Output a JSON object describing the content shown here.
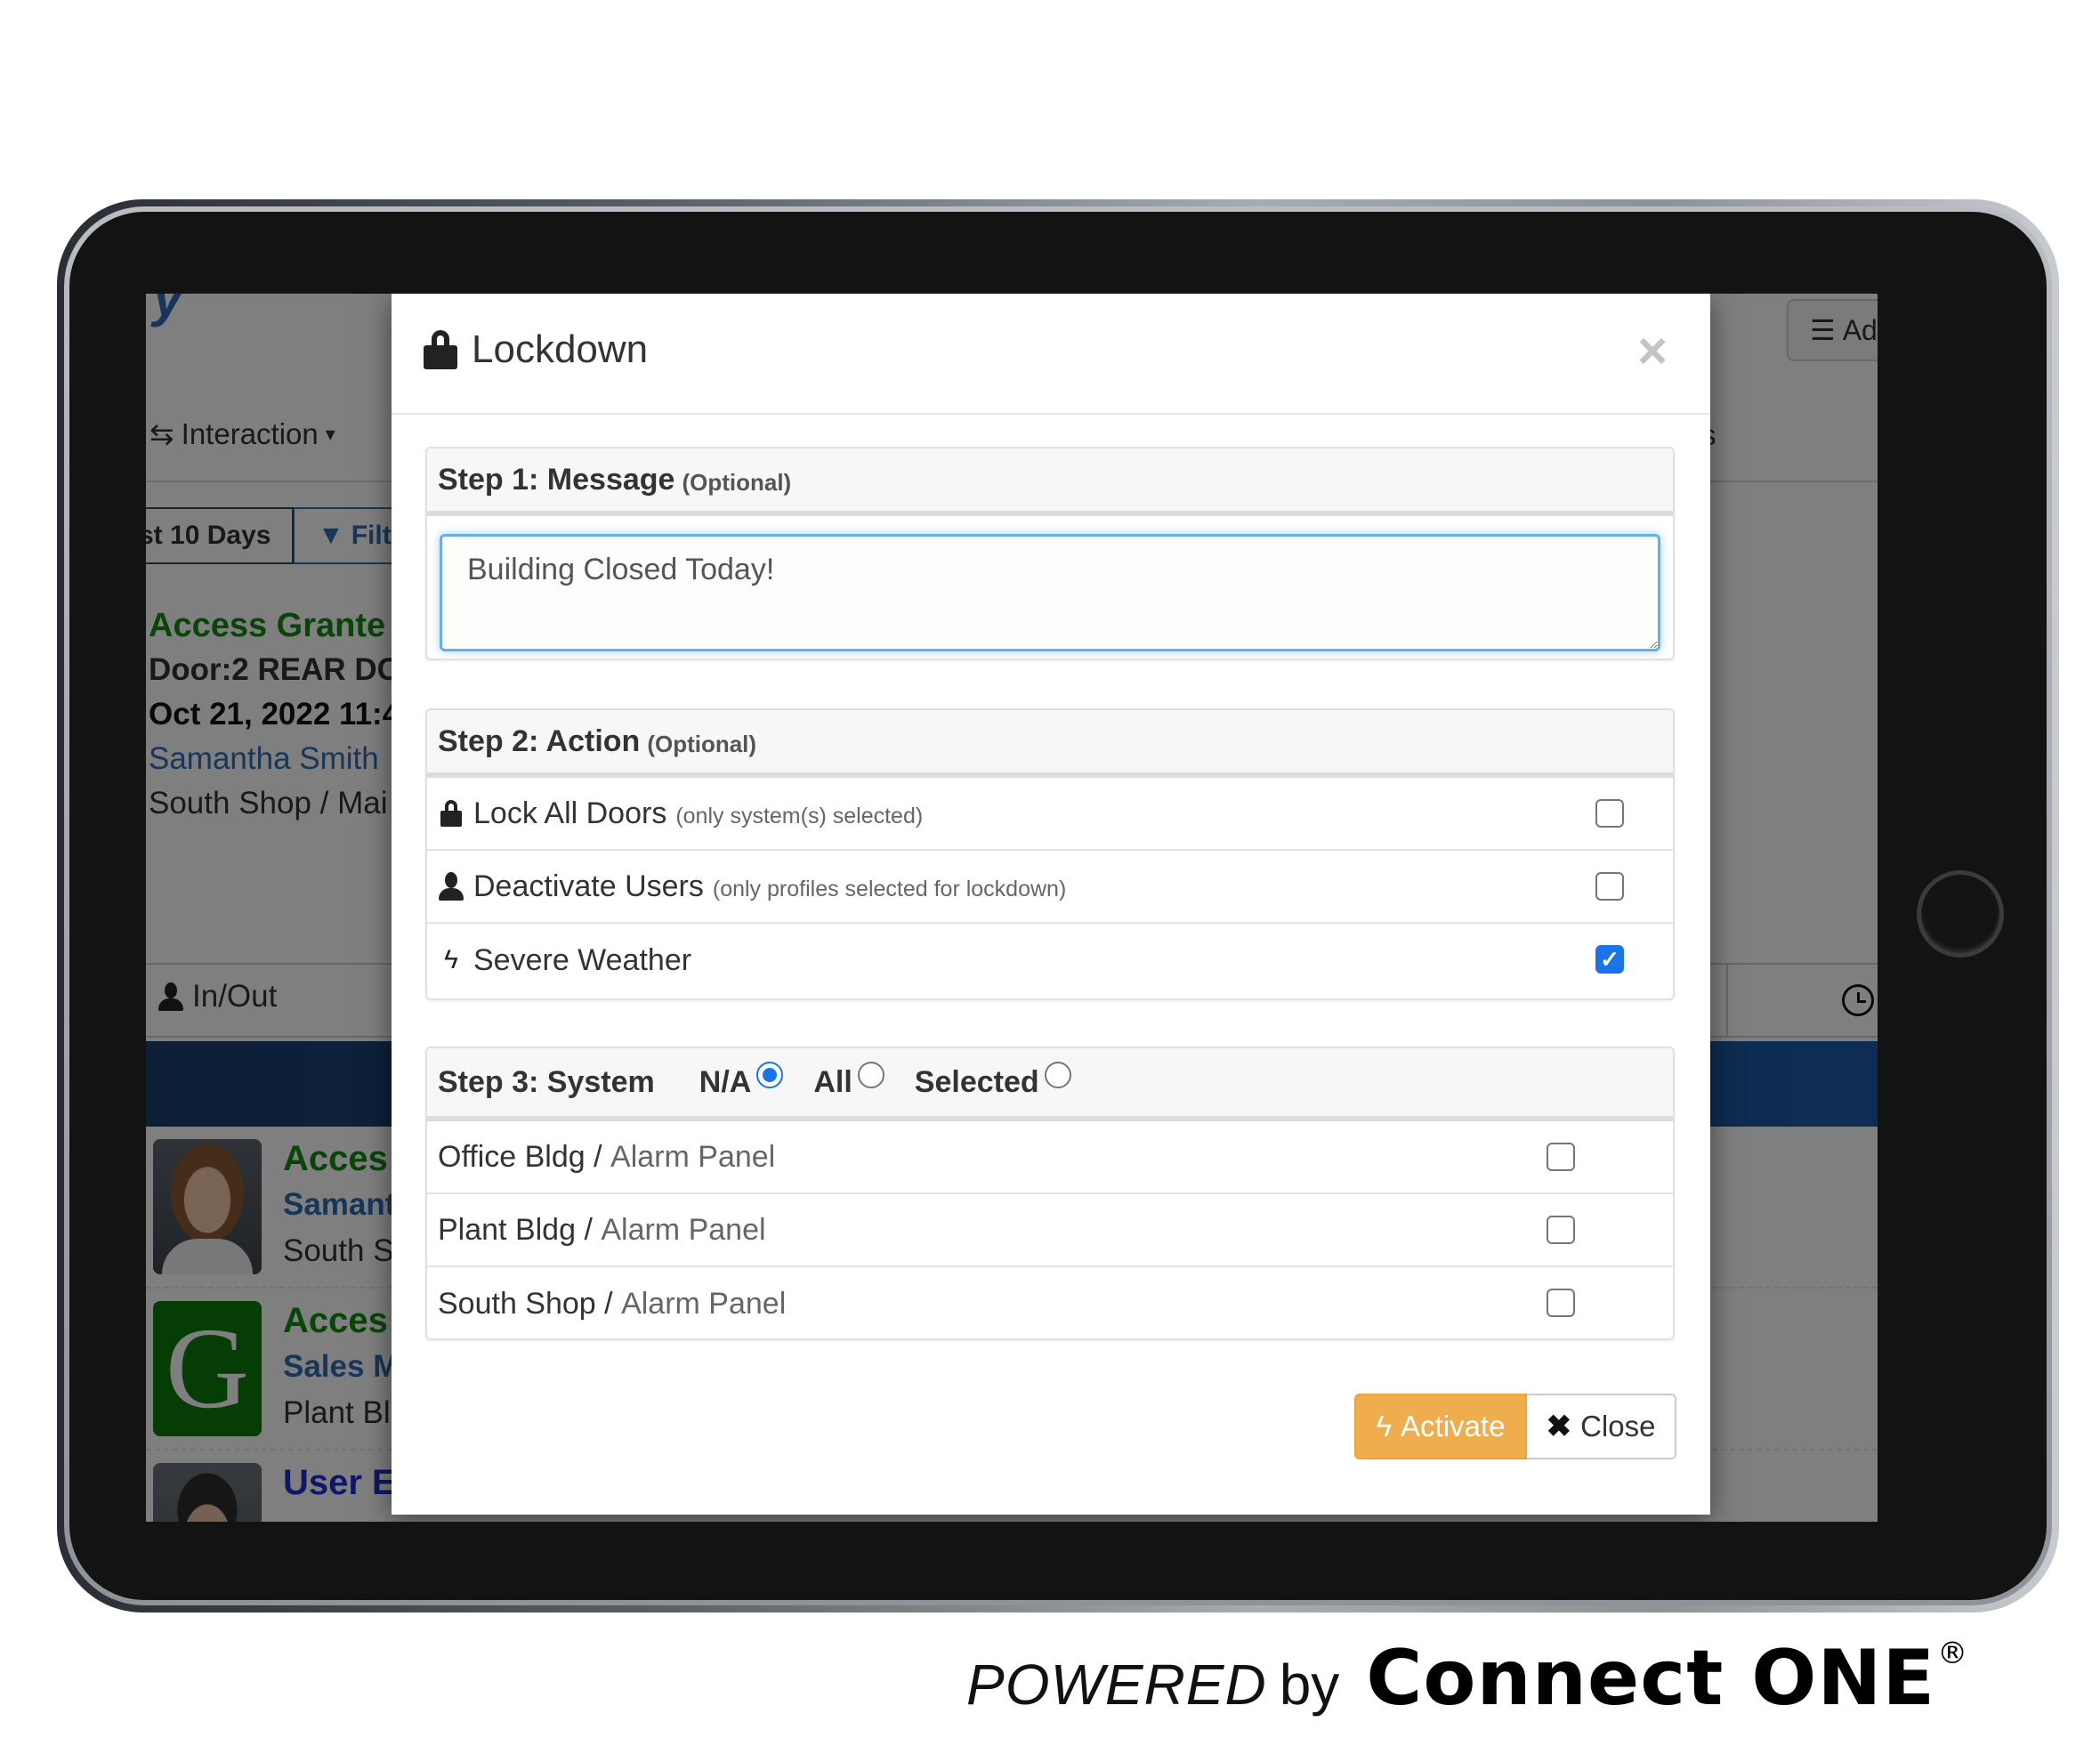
{
  "background_app": {
    "nav": {
      "interaction_label": "Interaction",
      "right_fragment": "s",
      "admin_fragment": "Ad"
    },
    "filters": {
      "days_label": "st 10 Days",
      "filter_label": "Filt"
    },
    "latest_event": {
      "status": "Access Grante",
      "door": "Door:2 REAR DC",
      "date": "Oct 21, 2022 11:4",
      "person": "Samantha Smith",
      "location": "South Shop / Mai"
    },
    "inout_label": "In/Out",
    "list": [
      {
        "avatar": "photo-woman",
        "line1": "Acces",
        "line2": "Samant",
        "line3": "South S"
      },
      {
        "avatar": "letter",
        "avatar_letter": "G",
        "line1": "Acces",
        "line2": "Sales M",
        "line3": "Plant Bl"
      },
      {
        "avatar": "photo-man",
        "line1": "User E"
      }
    ]
  },
  "modal": {
    "title": "Lockdown",
    "title_icon": "lock-icon",
    "close_glyph": "×",
    "step1": {
      "title": "Step 1: Message",
      "optional": "(Optional)",
      "message_value": "Building Closed Today!"
    },
    "step2": {
      "title": "Step 2: Action",
      "optional": "(Optional)",
      "actions": [
        {
          "icon": "lock-icon",
          "label": "Lock All Doors",
          "note": "(only system(s) selected)",
          "checked": false
        },
        {
          "icon": "user-icon",
          "label": "Deactivate Users",
          "note": "(only profiles selected for lockdown)",
          "checked": false
        },
        {
          "icon": "bolt-icon",
          "label": "Severe Weather",
          "note": "",
          "checked": true
        }
      ]
    },
    "step3": {
      "title": "Step 3: System",
      "options": [
        {
          "label": "N/A",
          "selected": true
        },
        {
          "label": "All",
          "selected": false
        },
        {
          "label": "Selected",
          "selected": false
        }
      ],
      "systems": [
        {
          "building": "Office Bldg /",
          "panel": "Alarm Panel",
          "checked": false
        },
        {
          "building": "Plant Bldg /",
          "panel": "Alarm Panel",
          "checked": false
        },
        {
          "building": "South Shop /",
          "panel": "Alarm Panel",
          "checked": false
        }
      ]
    },
    "footer": {
      "activate_label": "Activate",
      "close_label": "Close",
      "activate_color": "#f0ad4e"
    }
  },
  "branding": {
    "powered": "POWERED",
    "by": "by",
    "brand": "Connect ONE",
    "registered": "®"
  }
}
